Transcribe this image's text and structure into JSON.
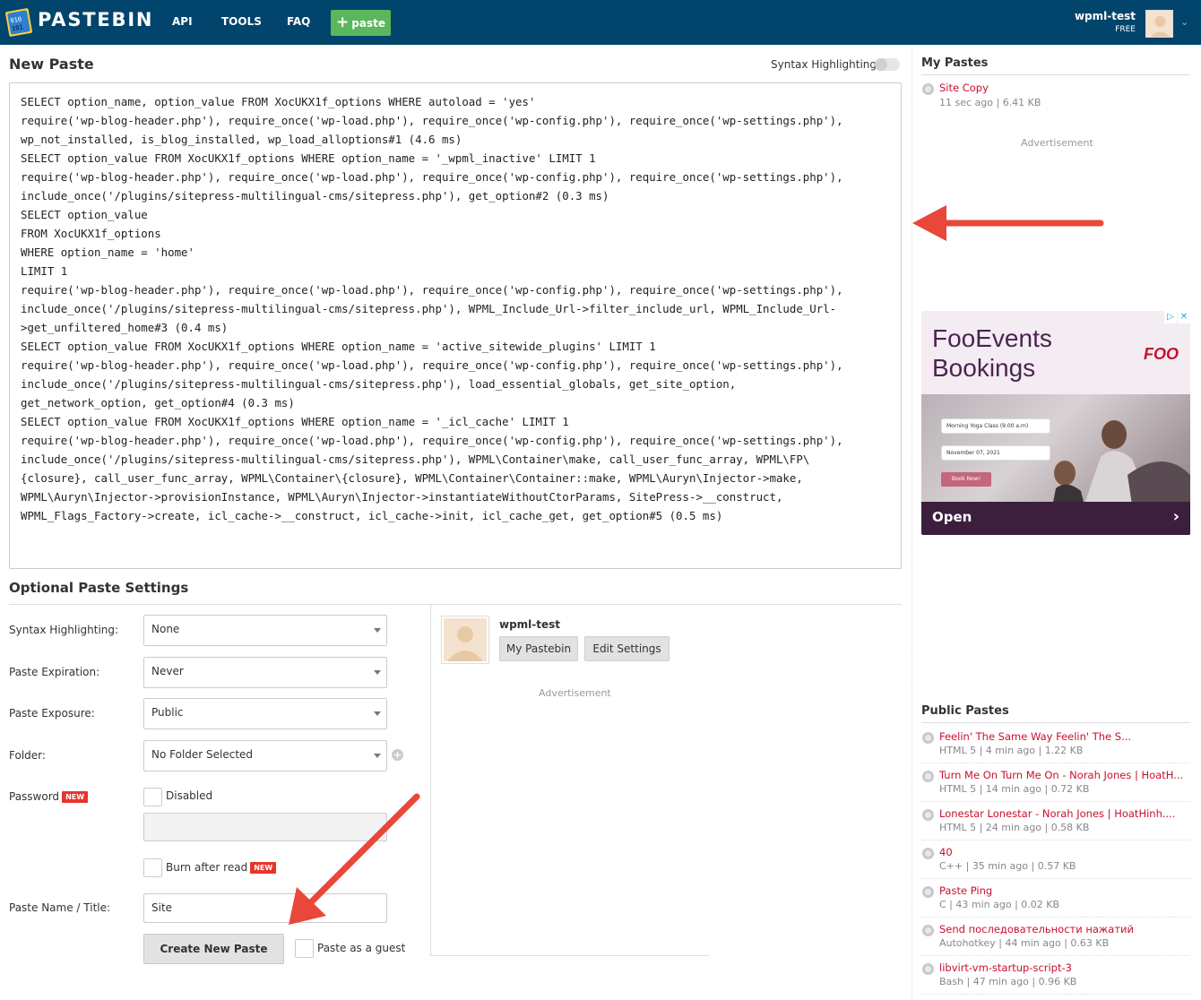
{
  "header": {
    "brand": "PASTEBIN",
    "nav": [
      "API",
      "TOOLS",
      "FAQ"
    ],
    "paste_button": "paste",
    "username": "wpml-test",
    "plan": "FREE"
  },
  "editor": {
    "title": "New Paste",
    "syntax_toggle_label": "Syntax Highlighting",
    "syntax_toggle_on": false,
    "lines": [
      "SELECT option_name, option_value FROM XocUKX1f_options WHERE autoload = 'yes'",
      "require('wp-blog-header.php'), require_once('wp-load.php'), require_once('wp-config.php'), require_once('wp-settings.php'),",
      "wp_not_installed, is_blog_installed, wp_load_alloptions#1 (4.6 ms)",
      "SELECT option_value FROM XocUKX1f_options WHERE option_name = '_wpml_inactive' LIMIT 1",
      "require('wp-blog-header.php'), require_once('wp-load.php'), require_once('wp-config.php'), require_once('wp-settings.php'),",
      "include_once('/plugins/sitepress-multilingual-cms/sitepress.php'), get_option#2 (0.3 ms)",
      "SELECT option_value",
      "FROM XocUKX1f_options",
      "WHERE option_name = 'home'",
      "LIMIT 1",
      "require('wp-blog-header.php'), require_once('wp-load.php'), require_once('wp-config.php'), require_once('wp-settings.php'),",
      "include_once('/plugins/sitepress-multilingual-cms/sitepress.php'), WPML_Include_Url->filter_include_url, WPML_Include_Url-",
      ">get_unfiltered_home#3 (0.4 ms)",
      "SELECT option_value FROM XocUKX1f_options WHERE option_name = 'active_sitewide_plugins' LIMIT 1",
      "require('wp-blog-header.php'), require_once('wp-load.php'), require_once('wp-config.php'), require_once('wp-settings.php'),",
      "include_once('/plugins/sitepress-multilingual-cms/sitepress.php'), load_essential_globals, get_site_option,",
      "get_network_option, get_option#4 (0.3 ms)",
      "SELECT option_value FROM XocUKX1f_options WHERE option_name = '_icl_cache' LIMIT 1",
      "require('wp-blog-header.php'), require_once('wp-load.php'), require_once('wp-config.php'), require_once('wp-settings.php'),",
      "include_once('/plugins/sitepress-multilingual-cms/sitepress.php'), WPML\\Container\\make, call_user_func_array, WPML\\FP\\",
      "{closure}, call_user_func_array, WPML\\Container\\{closure}, WPML\\Container\\Container::make, WPML\\Auryn\\Injector->make,",
      "WPML\\Auryn\\Injector->provisionInstance, WPML\\Auryn\\Injector->instantiateWithoutCtorParams, SitePress->__construct,",
      "WPML_Flags_Factory->create, icl_cache->__construct, icl_cache->init, icl_cache_get, get_option#5 (0.5 ms)"
    ]
  },
  "settings": {
    "title": "Optional Paste Settings",
    "syntax_label": "Syntax Highlighting:",
    "syntax_value": "None",
    "expiration_label": "Paste Expiration:",
    "expiration_value": "Never",
    "exposure_label": "Paste Exposure:",
    "exposure_value": "Public",
    "folder_label": "Folder:",
    "folder_value": "No Folder Selected",
    "password_label": "Password",
    "new_badge": "NEW",
    "disabled_label": "Disabled",
    "password_value": "",
    "burn_label": "Burn after read",
    "name_label": "Paste Name / Title:",
    "name_value": "Site",
    "create_button": "Create New Paste",
    "guest_label": "Paste as a guest"
  },
  "user_card": {
    "name": "wpml-test",
    "my_pastebin": "My Pastebin",
    "edit_settings": "Edit Settings",
    "ad_label": "Advertisement"
  },
  "sidebar": {
    "my_pastes_title": "My Pastes",
    "my_pastes": [
      {
        "title": "Site Copy",
        "meta": "11 sec ago | 6.41 KB"
      }
    ],
    "ad_label": "Advertisement",
    "public_title": "Public Pastes",
    "public_pastes": [
      {
        "title": "Feelin' The Same Way Feelin' The S...",
        "meta": "HTML 5 | 4 min ago | 1.22 KB"
      },
      {
        "title": "Turn Me On Turn Me On - Norah Jones | HoatH...",
        "meta": "HTML 5 | 14 min ago | 0.72 KB"
      },
      {
        "title": "Lonestar Lonestar - Norah Jones | HoatHinh....",
        "meta": "HTML 5 | 24 min ago | 0.58 KB"
      },
      {
        "title": "40",
        "meta": "C++ | 35 min ago | 0.57 KB"
      },
      {
        "title": "Paste Ping",
        "meta": "C | 43 min ago | 0.02 KB"
      },
      {
        "title": "Send последовательности нажатий",
        "meta": "Autohotkey | 44 min ago | 0.63 KB"
      },
      {
        "title": "libvirt-vm-startup-script-3",
        "meta": "Bash | 47 min ago | 0.96 KB"
      }
    ]
  },
  "ad": {
    "title_line1": "FooEvents",
    "title_line2": "Bookings",
    "brand": "FOO",
    "form_class": "Morning Yoga Class (9.00 a.m)",
    "form_date": "November 07, 2021",
    "book_button": "Book Now!",
    "cta": "Open",
    "cta_arrow": "›"
  },
  "colors": {
    "header_bg": "#02456c",
    "paste_button_bg": "#5cb65c",
    "link": "#c8102e",
    "annotation_arrow": "#e8473a"
  }
}
